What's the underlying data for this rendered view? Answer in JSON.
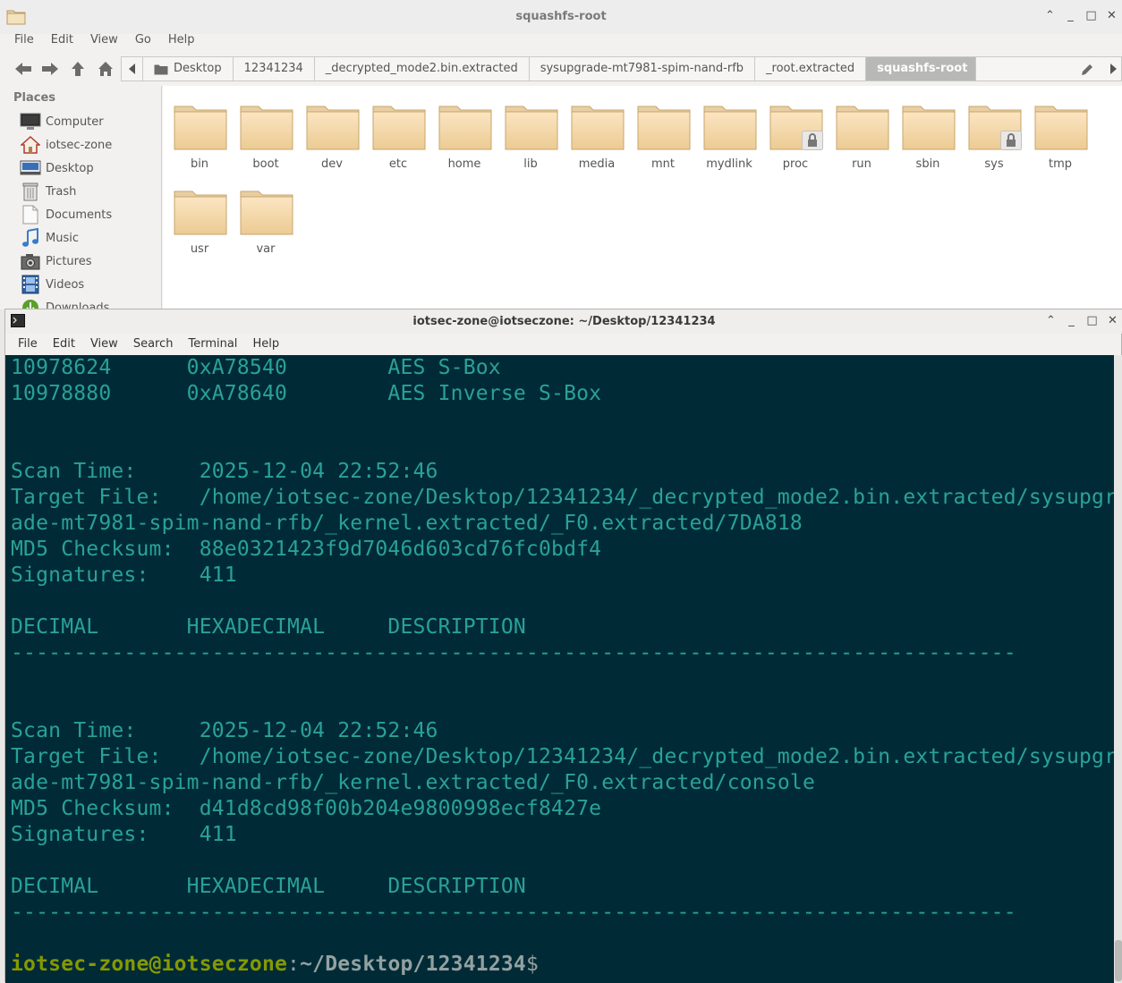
{
  "file_manager": {
    "title": "squashfs-root",
    "menu": [
      "File",
      "Edit",
      "View",
      "Go",
      "Help"
    ],
    "breadcrumbs": [
      "Desktop",
      "12341234",
      "_decrypted_mode2.bin.extracted",
      "sysupgrade-mt7981-spim-nand-rfb",
      "_root.extracted",
      "squashfs-root"
    ],
    "sidebar": {
      "title": "Places",
      "items": [
        {
          "label": "Computer",
          "icon": "computer-icon"
        },
        {
          "label": "iotsec-zone",
          "icon": "home-icon"
        },
        {
          "label": "Desktop",
          "icon": "desktop-icon"
        },
        {
          "label": "Trash",
          "icon": "trash-icon"
        },
        {
          "label": "Documents",
          "icon": "documents-icon"
        },
        {
          "label": "Music",
          "icon": "music-icon"
        },
        {
          "label": "Pictures",
          "icon": "pictures-icon"
        },
        {
          "label": "Videos",
          "icon": "videos-icon"
        },
        {
          "label": "Downloads",
          "icon": "downloads-icon"
        }
      ]
    },
    "folders": [
      {
        "name": "bin",
        "locked": false
      },
      {
        "name": "boot",
        "locked": false
      },
      {
        "name": "dev",
        "locked": false
      },
      {
        "name": "etc",
        "locked": false
      },
      {
        "name": "home",
        "locked": false
      },
      {
        "name": "lib",
        "locked": false
      },
      {
        "name": "media",
        "locked": false
      },
      {
        "name": "mnt",
        "locked": false
      },
      {
        "name": "mydlink",
        "locked": false
      },
      {
        "name": "proc",
        "locked": true
      },
      {
        "name": "run",
        "locked": false
      },
      {
        "name": "sbin",
        "locked": false
      },
      {
        "name": "sys",
        "locked": true
      },
      {
        "name": "tmp",
        "locked": false
      },
      {
        "name": "usr",
        "locked": false
      },
      {
        "name": "var",
        "locked": false
      }
    ]
  },
  "terminal": {
    "title": "iotsec-zone@iotseczone: ~/Desktop/12341234",
    "menu": [
      "File",
      "Edit",
      "View",
      "Search",
      "Terminal",
      "Help"
    ],
    "lines": [
      "10978624      0xA78540        AES S-Box",
      "10978880      0xA78640        AES Inverse S-Box",
      "",
      "",
      "Scan Time:     2025-12-04 22:52:46",
      "Target File:   /home/iotsec-zone/Desktop/12341234/_decrypted_mode2.bin.extracted/sysupgr",
      "ade-mt7981-spim-nand-rfb/_kernel.extracted/_F0.extracted/7DA818",
      "MD5 Checksum:  88e0321423f9d7046d603cd76fc0bdf4",
      "Signatures:    411",
      "",
      "DECIMAL       HEXADECIMAL     DESCRIPTION",
      "--------------------------------------------------------------------------------",
      "",
      "",
      "Scan Time:     2025-12-04 22:52:46",
      "Target File:   /home/iotsec-zone/Desktop/12341234/_decrypted_mode2.bin.extracted/sysupgr",
      "ade-mt7981-spim-nand-rfb/_kernel.extracted/_F0.extracted/console",
      "MD5 Checksum:  d41d8cd98f00b204e9800998ecf8427e",
      "Signatures:    411",
      "",
      "DECIMAL       HEXADECIMAL     DESCRIPTION",
      "--------------------------------------------------------------------------------",
      ""
    ],
    "prompt": {
      "user_host": "iotsec-zone@iotseczone",
      "colon": ":",
      "path": "~/Desktop/12341234",
      "symbol": "$"
    }
  }
}
